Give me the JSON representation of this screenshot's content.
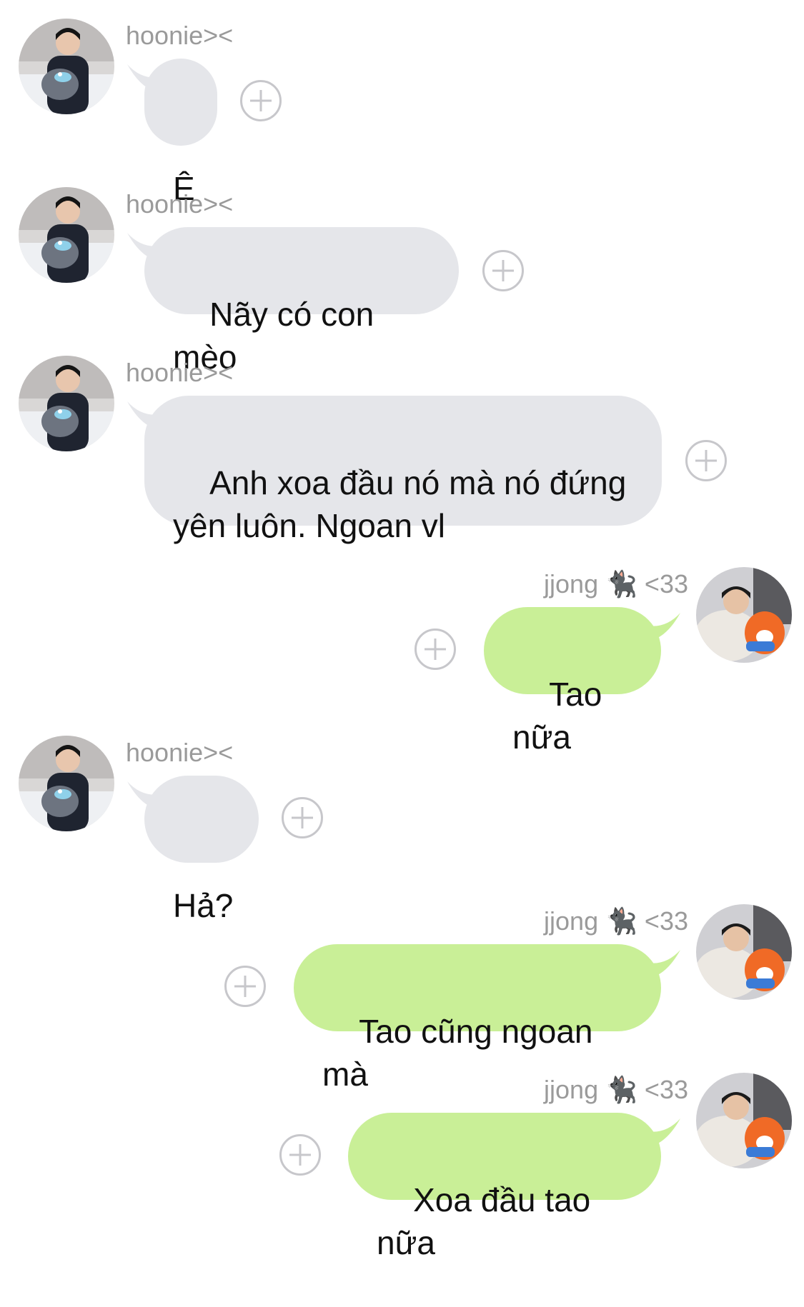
{
  "conversation": {
    "messages": [
      {
        "sender": "hoonie><",
        "side": "left",
        "text": "Ê"
      },
      {
        "sender": "hoonie><",
        "side": "left",
        "text": "Nãy có con mèo"
      },
      {
        "sender": "hoonie><",
        "side": "left",
        "text": "Anh xoa đầu nó mà nó đứng\nyên luôn. Ngoan vl"
      },
      {
        "sender": "jjong",
        "sender_suffix": "<33",
        "sender_emoji": "black-cat",
        "side": "right",
        "text": "Tao nữa"
      },
      {
        "sender": "hoonie><",
        "side": "left",
        "text": "Hả?"
      },
      {
        "sender": "jjong",
        "sender_suffix": "<33",
        "sender_emoji": "black-cat",
        "side": "right",
        "text": "Tao cũng ngoan mà"
      },
      {
        "sender": "jjong",
        "sender_suffix": "<33",
        "sender_emoji": "black-cat",
        "side": "right",
        "text": "Xoa đầu tao nữa"
      }
    ]
  },
  "colors": {
    "incoming_bubble": "#e5e6ea",
    "outgoing_bubble": "#c9ef97",
    "sender_name": "#9a9a9a",
    "add_reaction_icon": "#c7c7cb"
  },
  "icons": {
    "add_reaction": "plus-circle-icon",
    "sender_emoji": "black-cat"
  }
}
